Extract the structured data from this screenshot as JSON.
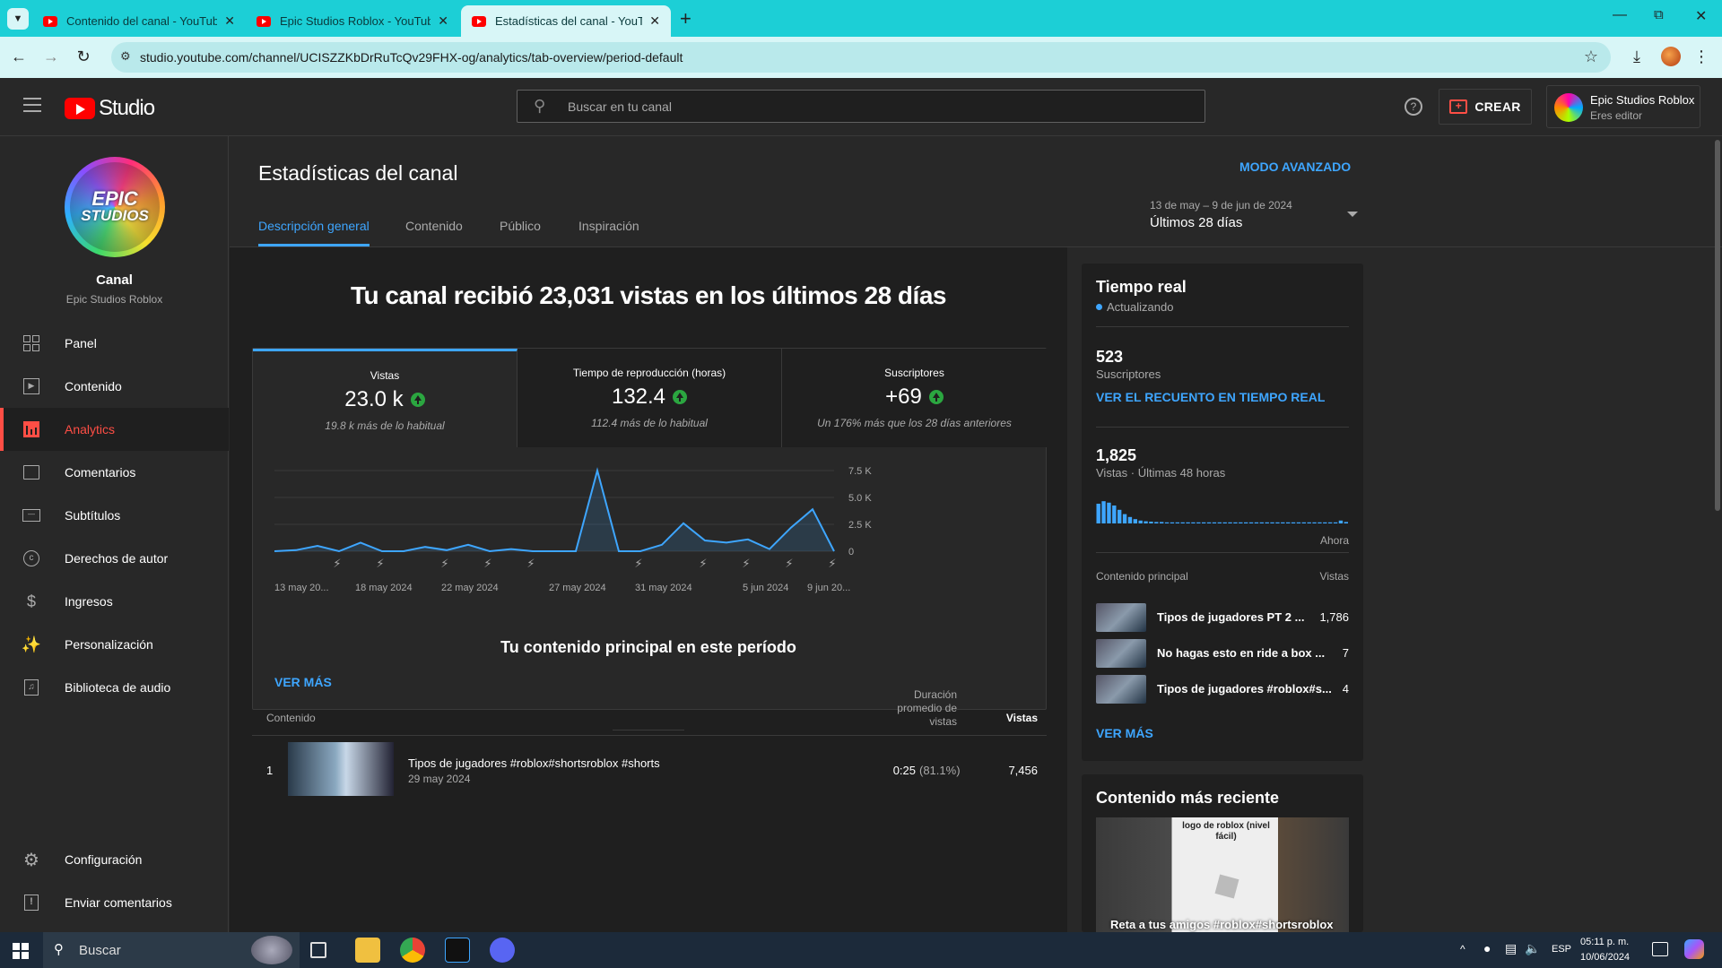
{
  "browser": {
    "tabs": [
      {
        "title": "Contenido del canal - YouTube"
      },
      {
        "title": "Epic Studios Roblox - YouTube"
      },
      {
        "title": "Estadísticas del canal - YouTube"
      }
    ],
    "url": "studio.youtube.com/channel/UCISZZKbDrRuTcQv29FHX-og/analytics/tab-overview/period-default"
  },
  "header": {
    "logo": "Studio",
    "search_placeholder": "Buscar en tu canal",
    "create_label": "CREAR",
    "account_name": "Epic Studios Roblox",
    "account_role": "Eres editor"
  },
  "sidebar": {
    "channel_label": "Canal",
    "channel_name": "Epic Studios Roblox",
    "logo_text_1": "EPIC",
    "logo_text_2": "STUDIOS",
    "items": [
      {
        "label": "Panel",
        "icon": "dashboard-icon"
      },
      {
        "label": "Contenido",
        "icon": "content-icon"
      },
      {
        "label": "Analytics",
        "icon": "analytics-icon"
      },
      {
        "label": "Comentarios",
        "icon": "comments-icon"
      },
      {
        "label": "Subtítulos",
        "icon": "subtitles-icon"
      },
      {
        "label": "Derechos de autor",
        "icon": "copyright-icon"
      },
      {
        "label": "Ingresos",
        "icon": "earn-icon"
      },
      {
        "label": "Personalización",
        "icon": "customization-icon"
      },
      {
        "label": "Biblioteca de audio",
        "icon": "audio-library-icon"
      }
    ],
    "settings_label": "Configuración",
    "feedback_label": "Enviar comentarios"
  },
  "page": {
    "title": "Estadísticas del canal",
    "advanced_mode": "MODO AVANZADO",
    "tabs": [
      "Descripción general",
      "Contenido",
      "Público",
      "Inspiración"
    ],
    "date_range": "13 de may – 9 de jun de 2024",
    "period": "Últimos 28 días",
    "headline": "Tu canal recibió 23,031 vistas en los últimos 28 días",
    "kpis": [
      {
        "label": "Vistas",
        "value": "23.0 k",
        "sub": "19.8 k más de lo habitual"
      },
      {
        "label": "Tiempo de reproducción (horas)",
        "value": "132.4",
        "sub": "112.4 más de lo habitual"
      },
      {
        "label": "Suscriptores",
        "value": "+69",
        "sub": "Un 176% más que los 28 días anteriores"
      }
    ],
    "see_more": "VER MÁS",
    "top_content_title": "Tu contenido principal en este período",
    "table_headers": {
      "content": "Contenido",
      "duration": "Duración promedio de vistas",
      "views": "Vistas"
    },
    "table_rows": [
      {
        "rank": "1",
        "title": "Tipos de jugadores #roblox#shortsroblox #shorts",
        "date": "29 may 2024",
        "duration": "0:25",
        "pct": "(81.1%)",
        "views": "7,456"
      }
    ]
  },
  "chart_data": {
    "type": "area",
    "x_tick_labels": [
      "13 may 20...",
      "18 may 2024",
      "22 may 2024",
      "27 may 2024",
      "31 may 2024",
      "5 jun 2024",
      "9 jun 20..."
    ],
    "y_tick_labels": [
      "7.5 K",
      "5.0 K",
      "2.5 K",
      "0"
    ],
    "ylim": [
      0,
      7500
    ],
    "values": [
      0,
      100,
      500,
      0,
      800,
      0,
      0,
      400,
      100,
      600,
      0,
      200,
      0,
      0,
      0,
      7500,
      0,
      0,
      600,
      2600,
      1000,
      800,
      1100,
      200,
      2200,
      3900,
      0
    ],
    "color": "#3ea6ff",
    "grid": true
  },
  "realtime": {
    "title": "Tiempo real",
    "status": "Actualizando",
    "subs_value": "523",
    "subs_label": "Suscriptores",
    "subs_link": "VER EL RECUENTO EN TIEMPO REAL",
    "views_value": "1,825",
    "views_label": "Vistas · Últimas 48 horas",
    "now_label": "Ahora",
    "bars": [
      0.55,
      0.62,
      0.58,
      0.5,
      0.38,
      0.26,
      0.18,
      0.12,
      0.08,
      0.06,
      0.05,
      0.04,
      0.04,
      0.03,
      0.03,
      0.03,
      0.03,
      0.03,
      0.03,
      0.03,
      0.03,
      0.03,
      0.03,
      0.03,
      0.03,
      0.03,
      0.03,
      0.03,
      0.03,
      0.03,
      0.03,
      0.03,
      0.03,
      0.03,
      0.03,
      0.03,
      0.03,
      0.03,
      0.03,
      0.03,
      0.03,
      0.03,
      0.03,
      0.03,
      0.03,
      0.03,
      0.08,
      0.04
    ],
    "top_content_label": "Contenido principal",
    "views_col_label": "Vistas",
    "items": [
      {
        "title": "Tipos de jugadores PT 2 ...",
        "views": "1,786"
      },
      {
        "title": "No hagas esto en ride a box ...",
        "views": "7"
      },
      {
        "title": "Tipos de jugadores #roblox#s...",
        "views": "4"
      }
    ],
    "see_more": "VER MÁS"
  },
  "latest": {
    "title": "Contenido más reciente",
    "video_caption": "Reta a tus amigos #roblox#shortsroblox",
    "thumb_text": "logo de roblox (nivel fácil)"
  },
  "taskbar": {
    "search": "Buscar",
    "lang": "ESP",
    "time": "05:11 p. m.",
    "date": "10/06/2024"
  }
}
